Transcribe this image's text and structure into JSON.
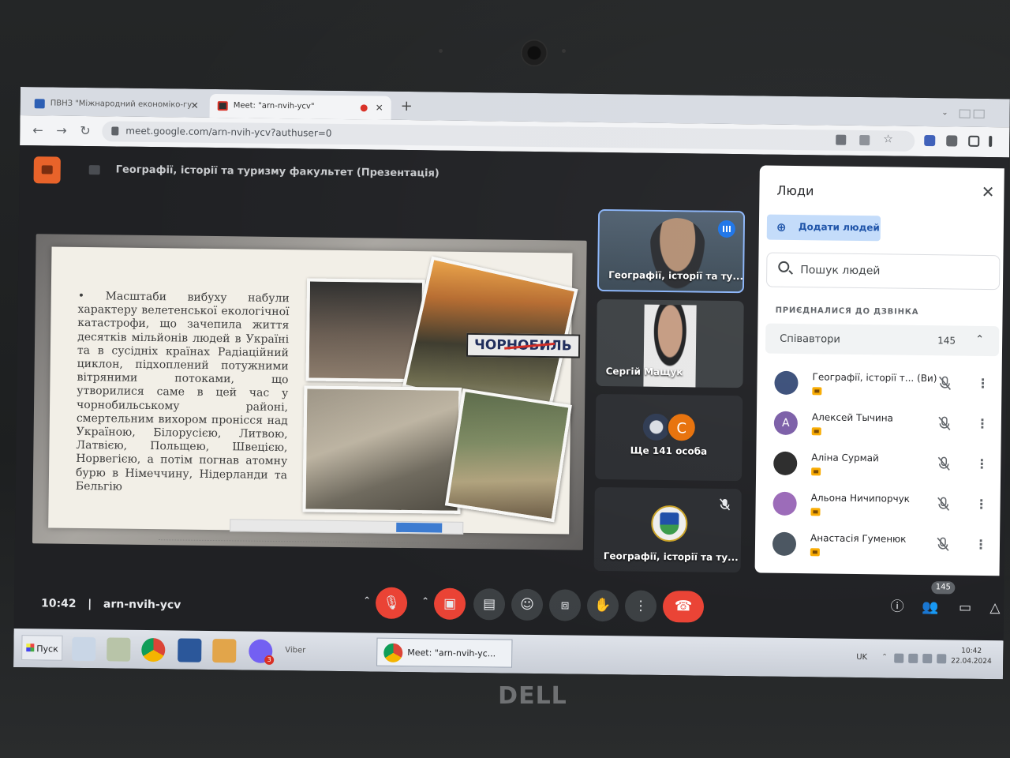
{
  "browser": {
    "tabs": [
      {
        "title": "ПВНЗ \"Міжнародний економіко-гу",
        "active": false
      },
      {
        "title": "Meet: \"arn-nvih-ycv\"",
        "active": true
      }
    ],
    "new_tab_label": "+",
    "url": "meet.google.com/arn-nvih-ycv?authuser=0"
  },
  "meet": {
    "presentation_title": "Географії, історії та туризму факультет (Презентація)",
    "slide": {
      "text": "• Масштаби вибуху набули характеру велетенської екологічної катастрофи, що зачепила життя десятків мільйонів людей в Україні та в сусідніх країнах Радіаційний циклон, підхоплений потужними вітряними потоками, що утворилися саме в цей час у чорнобильському районі, смертельним вихором пронісся над Україною, Білорусією, Литвою, Латвією, Польщею, Швецією, Норвегією, а потім погнав атомну бурю в Німеччину, Нідерланди та Бельгію",
      "sign_text": "ЧОРНОБИЛЬ"
    },
    "tiles": [
      {
        "name": "Географії, історії та ту..."
      },
      {
        "name": "Сергій Мащук"
      },
      {
        "name": "Ще 141 особа",
        "avatar_letter": "С"
      },
      {
        "name": "Географії, історії та ту..."
      }
    ],
    "controls": {
      "time": "10:42",
      "separator": "|",
      "meeting_code": "arn-nvih-ycv",
      "participant_count": "145"
    }
  },
  "people_panel": {
    "title": "Люди",
    "add_people_label": "Додати людей",
    "search_placeholder": "Пошук людей",
    "joined_label": "ПРИЄДНАЛИСЯ ДО ДЗВІНКА",
    "group_label": "Співавтори",
    "group_count": "145",
    "participants": [
      {
        "name": "Географії, історії т...  (Ви)",
        "avatar_letter": "",
        "avatar_color": "#3b4f7a"
      },
      {
        "name": "Алексей Тычина",
        "avatar_letter": "А",
        "avatar_color": "#7b5ea7"
      },
      {
        "name": "Аліна Сурмай",
        "avatar_letter": "",
        "avatar_color": "#2b2b2b"
      },
      {
        "name": "Альона Ничипорчук",
        "avatar_letter": "",
        "avatar_color": "#9b6ab8"
      },
      {
        "name": "Анастасія Гуменюк",
        "avatar_letter": "",
        "avatar_color": "#4a5560"
      }
    ]
  },
  "taskbar": {
    "start_label": "Пуск",
    "viber_label": "Viber",
    "viber_badge": "3",
    "active_task": "Meet: \"arn-nvih-yc...",
    "language": "UK",
    "clock_time": "10:42",
    "clock_date": "22.04.2024"
  },
  "device": {
    "brand": "DELL"
  },
  "colors": {
    "accent": "#1a73e8",
    "danger": "#ea4335",
    "meet_bg": "#202124"
  }
}
